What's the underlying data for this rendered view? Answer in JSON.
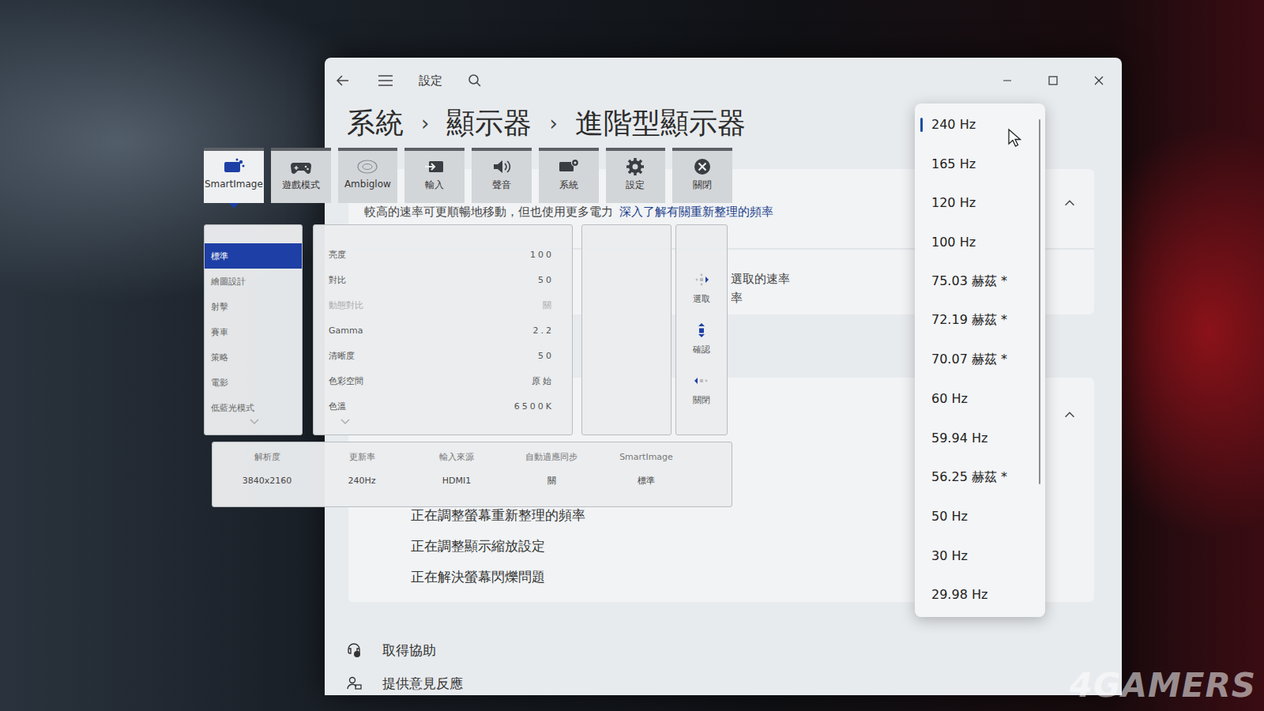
{
  "window": {
    "title": "設定"
  },
  "breadcrumb": {
    "items": [
      "系統",
      "顯示器",
      "進階型顯示器"
    ],
    "separator": "›"
  },
  "refresh_card": {
    "description": "較高的速率可更順暢地移動，但也使用更多電力",
    "link": "深入了解有關重新整理的頻率",
    "expanded": true,
    "partial_lines": [
      "選取的速率",
      "率"
    ]
  },
  "support_card": {
    "expanded": true,
    "links": [
      "正在調整螢幕重新整理的頻率",
      "正在調整顯示縮放設定",
      "正在解決螢幕閃爍問題"
    ]
  },
  "footer_links": [
    "取得協助",
    "提供意見反應"
  ],
  "refresh_dropdown": {
    "items": [
      {
        "label": "240 Hz",
        "selected": true
      },
      {
        "label": "165 Hz",
        "selected": false
      },
      {
        "label": "120 Hz",
        "selected": false
      },
      {
        "label": "100 Hz",
        "selected": false
      },
      {
        "label": "75.03 赫茲 *",
        "selected": false
      },
      {
        "label": "72.19 赫茲 *",
        "selected": false
      },
      {
        "label": "70.07 赫茲 *",
        "selected": false
      },
      {
        "label": "60 Hz",
        "selected": false
      },
      {
        "label": "59.94 Hz",
        "selected": false
      },
      {
        "label": "56.25 赫茲 *",
        "selected": false
      },
      {
        "label": "50 Hz",
        "selected": false
      },
      {
        "label": "30 Hz",
        "selected": false
      },
      {
        "label": "29.98 Hz",
        "selected": false
      }
    ]
  },
  "osd": {
    "tabs": [
      {
        "label": "SmartImage",
        "selected": true
      },
      {
        "label": "遊戲模式",
        "selected": false
      },
      {
        "label": "Ambiglow",
        "selected": false
      },
      {
        "label": "輸入",
        "selected": false
      },
      {
        "label": "聲音",
        "selected": false
      },
      {
        "label": "系統",
        "selected": false
      },
      {
        "label": "設定",
        "selected": false
      },
      {
        "label": "關閉",
        "selected": false
      }
    ],
    "modes": [
      {
        "label": "標準",
        "selected": true
      },
      {
        "label": "繪圖設計",
        "selected": false
      },
      {
        "label": "射擊",
        "selected": false
      },
      {
        "label": "賽車",
        "selected": false
      },
      {
        "label": "策略",
        "selected": false
      },
      {
        "label": "電影",
        "selected": false
      },
      {
        "label": "低藍光模式",
        "selected": false
      }
    ],
    "settings": [
      {
        "label": "亮度",
        "value": "100",
        "disabled": false
      },
      {
        "label": "對比",
        "value": "50",
        "disabled": false
      },
      {
        "label": "動態對比",
        "value": "關",
        "disabled": true
      },
      {
        "label": "Gamma",
        "value": "2.2",
        "disabled": false
      },
      {
        "label": "清晰度",
        "value": "50",
        "disabled": false
      },
      {
        "label": "色彩空間",
        "value": "原始",
        "disabled": false
      },
      {
        "label": "色溫",
        "value": "6500K",
        "disabled": false
      }
    ],
    "nav_hints": [
      "選取",
      "確認",
      "關閉"
    ],
    "status": [
      {
        "label": "解析度",
        "value": "3840x2160"
      },
      {
        "label": "更新率",
        "value": "240Hz"
      },
      {
        "label": "輸入來源",
        "value": "HDMI1"
      },
      {
        "label": "自動適應同步",
        "value": "關"
      },
      {
        "label": "SmartImage",
        "value": "標準"
      }
    ]
  },
  "watermark": "4GAMERS"
}
